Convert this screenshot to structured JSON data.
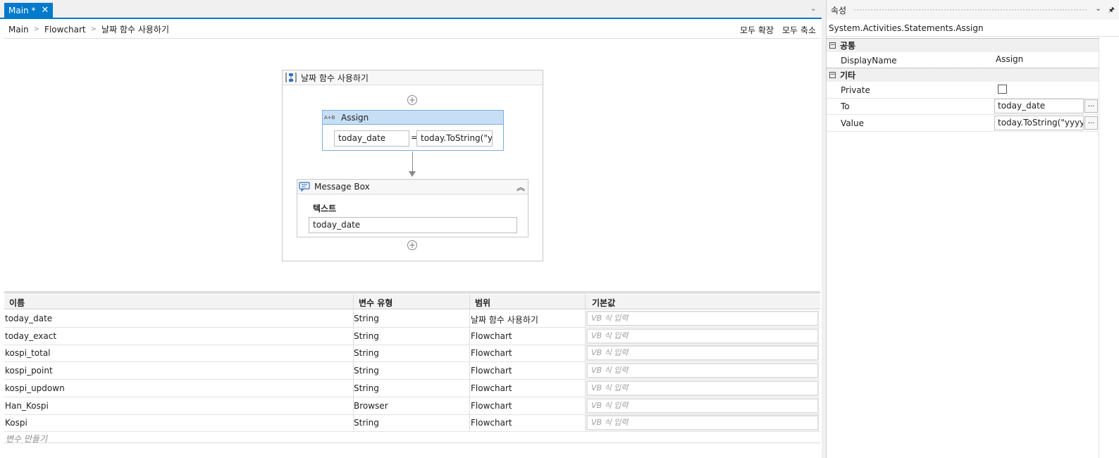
{
  "tab": {
    "title": "Main *",
    "close": "✕",
    "dropdown": "⌄"
  },
  "breadcrumb": {
    "items": [
      "Main",
      "Flowchart",
      "날짜 함수 사용하기"
    ],
    "sep": ">",
    "expand_all": "모두 확장",
    "collapse_all": "모두 축소"
  },
  "sequence": {
    "title": "날짜 함수 사용하기",
    "add": "+"
  },
  "assign": {
    "icon": "A+B",
    "title": "Assign",
    "to": "today_date",
    "eq": "=",
    "value": "today.ToString(\"yy"
  },
  "message_box": {
    "title": "Message Box",
    "collapse": "︽",
    "label": "텍스트",
    "value": "today_date"
  },
  "variables": {
    "headers": [
      "이름",
      "변수 유형",
      "범위",
      "기본값"
    ],
    "default_placeholder": "VB 식 입력",
    "rows": [
      {
        "name": "today_date",
        "type": "String",
        "scope": "날짜 함수 사용하기"
      },
      {
        "name": "today_exact",
        "type": "String",
        "scope": "Flowchart"
      },
      {
        "name": "kospi_total",
        "type": "String",
        "scope": "Flowchart"
      },
      {
        "name": "kospi_point",
        "type": "String",
        "scope": "Flowchart"
      },
      {
        "name": "kospi_updown",
        "type": "String",
        "scope": "Flowchart"
      },
      {
        "name": "Han_Kospi",
        "type": "Browser",
        "scope": "Flowchart"
      },
      {
        "name": "Kospi",
        "type": "String",
        "scope": "Flowchart"
      }
    ],
    "create": "변수 만들기"
  },
  "properties": {
    "title": "속성",
    "type": "System.Activities.Statements.Assign",
    "btn_dropdown": "⌄",
    "btn_pin": "🖈",
    "categories": [
      {
        "name": "공통",
        "toggle": "−"
      },
      {
        "name": "기타",
        "toggle": "−"
      }
    ],
    "display_name": {
      "label": "DisplayName",
      "value": "Assign"
    },
    "private": {
      "label": "Private"
    },
    "to": {
      "label": "To",
      "value": "today_date",
      "dots": "..."
    },
    "value": {
      "label": "Value",
      "value": "today.ToString(\"yyyy/I",
      "dots": "..."
    }
  },
  "colors": {
    "accent": "#007acc",
    "assign_header": "#c7dff5"
  }
}
